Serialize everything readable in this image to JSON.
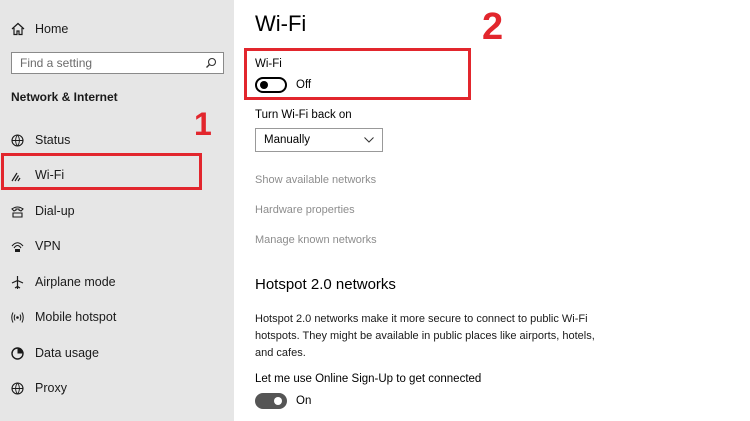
{
  "sidebar": {
    "home_label": "Home",
    "search_placeholder": "Find a setting",
    "section_title": "Network & Internet",
    "items": [
      {
        "label": "Status",
        "icon": "globe-icon"
      },
      {
        "label": "Wi-Fi",
        "icon": "wifi-icon"
      },
      {
        "label": "Dial-up",
        "icon": "phone-icon"
      },
      {
        "label": "VPN",
        "icon": "vpn-icon"
      },
      {
        "label": "Airplane mode",
        "icon": "airplane-icon"
      },
      {
        "label": "Mobile hotspot",
        "icon": "hotspot-icon"
      },
      {
        "label": "Data usage",
        "icon": "data-usage-icon"
      },
      {
        "label": "Proxy",
        "icon": "globe-icon"
      }
    ]
  },
  "main": {
    "title": "Wi-Fi",
    "wifi_toggle": {
      "label": "Wi-Fi",
      "state": "Off",
      "on": false
    },
    "turn_back_on": {
      "label": "Turn Wi-Fi back on",
      "value": "Manually"
    },
    "links": [
      "Show available networks",
      "Hardware properties",
      "Manage known networks"
    ],
    "hotspot": {
      "title": "Hotspot 2.0 networks",
      "description": "Hotspot 2.0 networks make it more secure to connect to public Wi-Fi hotspots. They might be available in public places like airports, hotels, and cafes.",
      "signup_label": "Let me use Online Sign-Up to get connected",
      "signup_state": "On",
      "signup_on": true
    }
  },
  "annotations": {
    "marker_1": "1",
    "marker_2": "2",
    "color": "#e2262d"
  }
}
